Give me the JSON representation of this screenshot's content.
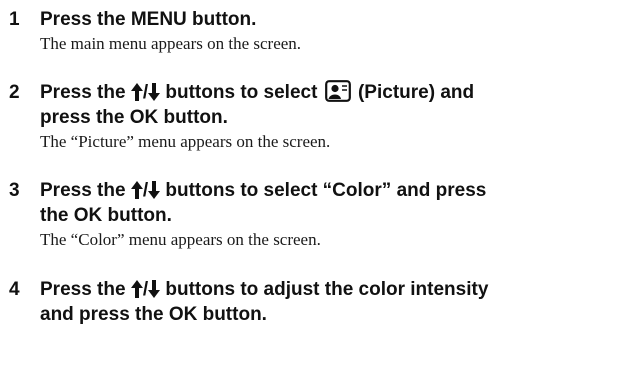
{
  "steps": [
    {
      "number": "1",
      "title": "Press the MENU button.",
      "description": "The main menu appears on the screen."
    },
    {
      "number": "2",
      "title_part1": "Press the",
      "title_sep": "/",
      "title_part2": "buttons to select",
      "title_part3": "(Picture) and",
      "title_line2": "press the OK button.",
      "description": "The “Picture” menu appears on the screen."
    },
    {
      "number": "3",
      "title_part1": "Press the",
      "title_sep": "/",
      "title_part2": "buttons to select “Color” and press",
      "title_line2": "the OK button.",
      "description": "The “Color” menu appears on the screen."
    },
    {
      "number": "4",
      "title_part1": "Press the",
      "title_sep": "/",
      "title_part2": "buttons to adjust the color intensity",
      "title_line2": "and press the OK button."
    }
  ],
  "icons": {
    "up": "up-arrow-icon",
    "down": "down-arrow-icon",
    "picture": "picture-icon"
  },
  "colors": {
    "text": "#111111"
  }
}
